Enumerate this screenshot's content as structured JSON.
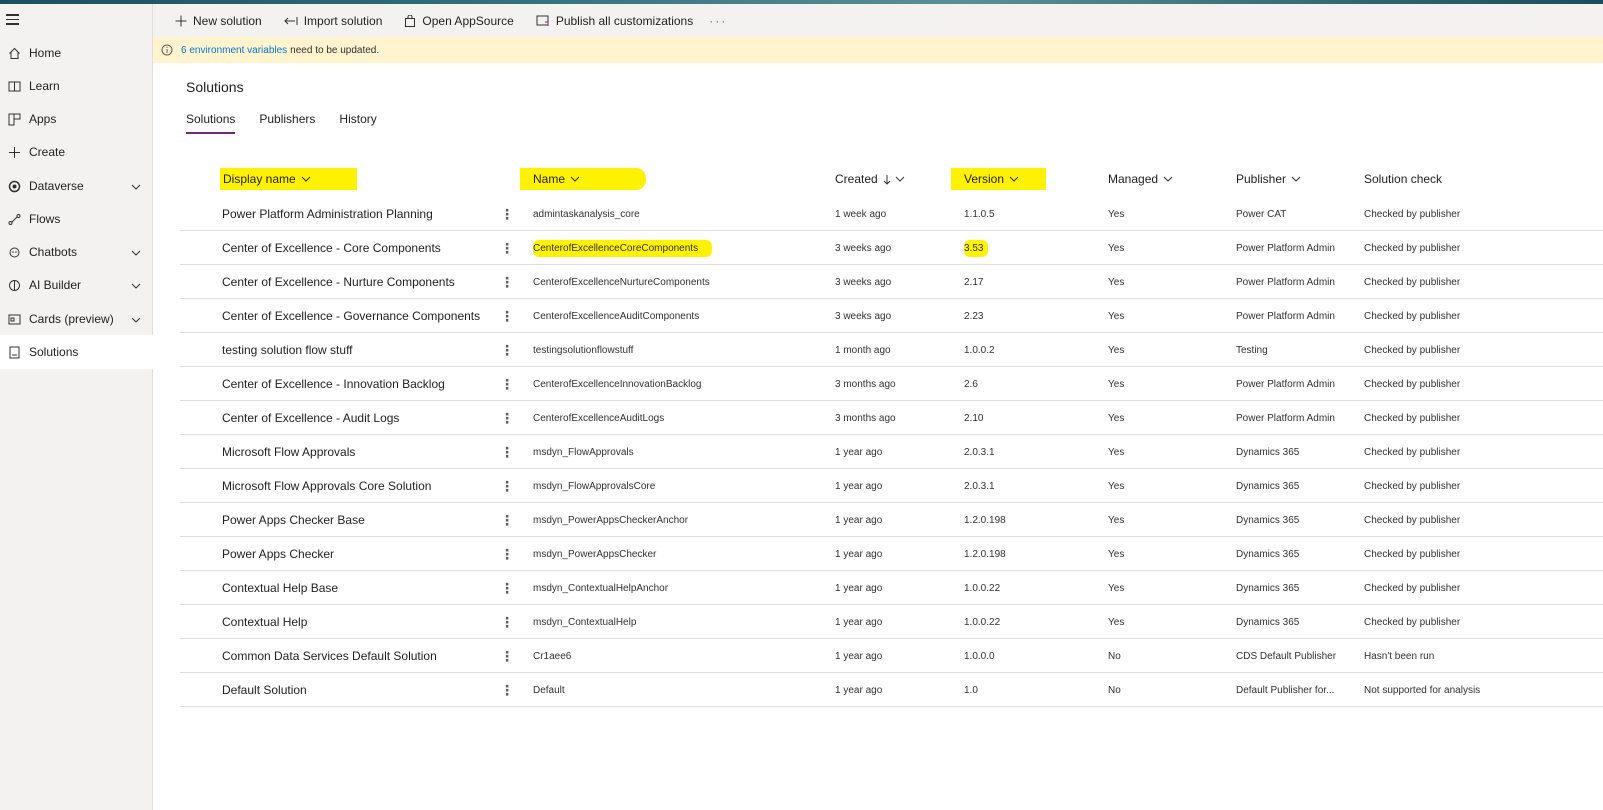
{
  "command_bar": {
    "new_solution": "New solution",
    "import_solution": "Import solution",
    "open_appsource": "Open AppSource",
    "publish_all": "Publish all customizations",
    "more": "···"
  },
  "banner": {
    "link_text": "6 environment variables",
    "rest_text": "need to be updated."
  },
  "sidebar": {
    "items": [
      {
        "label": "Home",
        "icon": "home-icon"
      },
      {
        "label": "Learn",
        "icon": "book-icon"
      },
      {
        "label": "Apps",
        "icon": "apps-icon"
      },
      {
        "label": "Create",
        "icon": "plus-icon"
      },
      {
        "label": "Dataverse",
        "icon": "dataverse-icon",
        "expandable": true
      },
      {
        "label": "Flows",
        "icon": "flow-icon"
      },
      {
        "label": "Chatbots",
        "icon": "chatbot-icon",
        "expandable": true
      },
      {
        "label": "AI Builder",
        "icon": "ai-builder-icon",
        "expandable": true
      },
      {
        "label": "Cards (preview)",
        "icon": "cards-icon",
        "expandable": true
      },
      {
        "label": "Solutions",
        "icon": "solutions-icon",
        "active": true
      }
    ]
  },
  "page": {
    "title": "Solutions",
    "tabs": [
      "Solutions",
      "Publishers",
      "History"
    ],
    "active_tab": "Solutions"
  },
  "columns": {
    "display_name": "Display name",
    "name": "Name",
    "created": "Created",
    "version": "Version",
    "managed": "Managed",
    "publisher": "Publisher",
    "solution_check": "Solution check"
  },
  "rows": [
    {
      "display_name": "Power Platform Administration Planning",
      "name": "admintaskanalysis_core",
      "created": "1 week ago",
      "version": "1.1.0.5",
      "managed": "Yes",
      "publisher": "Power CAT",
      "check": "Checked by publisher"
    },
    {
      "display_name": "Center of Excellence - Core Components",
      "name": "CenterofExcellenceCoreComponents",
      "created": "3 weeks ago",
      "version": "3.53",
      "managed": "Yes",
      "publisher": "Power Platform Admin",
      "check": "Checked by publisher"
    },
    {
      "display_name": "Center of Excellence - Nurture Components",
      "name": "CenterofExcellenceNurtureComponents",
      "created": "3 weeks ago",
      "version": "2.17",
      "managed": "Yes",
      "publisher": "Power Platform Admin",
      "check": "Checked by publisher"
    },
    {
      "display_name": "Center of Excellence - Governance Components",
      "name": "CenterofExcellenceAuditComponents",
      "created": "3 weeks ago",
      "version": "2.23",
      "managed": "Yes",
      "publisher": "Power Platform Admin",
      "check": "Checked by publisher"
    },
    {
      "display_name": "testing solution flow stuff",
      "name": "testingsolutionflowstuff",
      "created": "1 month ago",
      "version": "1.0.0.2",
      "managed": "Yes",
      "publisher": "Testing",
      "check": "Checked by publisher"
    },
    {
      "display_name": "Center of Excellence - Innovation Backlog",
      "name": "CenterofExcellenceInnovationBacklog",
      "created": "3 months ago",
      "version": "2.6",
      "managed": "Yes",
      "publisher": "Power Platform Admin",
      "check": "Checked by publisher"
    },
    {
      "display_name": "Center of Excellence - Audit Logs",
      "name": "CenterofExcellenceAuditLogs",
      "created": "3 months ago",
      "version": "2.10",
      "managed": "Yes",
      "publisher": "Power Platform Admin",
      "check": "Checked by publisher"
    },
    {
      "display_name": "Microsoft Flow Approvals",
      "name": "msdyn_FlowApprovals",
      "created": "1 year ago",
      "version": "2.0.3.1",
      "managed": "Yes",
      "publisher": "Dynamics 365",
      "check": "Checked by publisher"
    },
    {
      "display_name": "Microsoft Flow Approvals Core Solution",
      "name": "msdyn_FlowApprovalsCore",
      "created": "1 year ago",
      "version": "2.0.3.1",
      "managed": "Yes",
      "publisher": "Dynamics 365",
      "check": "Checked by publisher"
    },
    {
      "display_name": "Power Apps Checker Base",
      "name": "msdyn_PowerAppsCheckerAnchor",
      "created": "1 year ago",
      "version": "1.2.0.198",
      "managed": "Yes",
      "publisher": "Dynamics 365",
      "check": "Checked by publisher"
    },
    {
      "display_name": "Power Apps Checker",
      "name": "msdyn_PowerAppsChecker",
      "created": "1 year ago",
      "version": "1.2.0.198",
      "managed": "Yes",
      "publisher": "Dynamics 365",
      "check": "Checked by publisher"
    },
    {
      "display_name": "Contextual Help Base",
      "name": "msdyn_ContextualHelpAnchor",
      "created": "1 year ago",
      "version": "1.0.0.22",
      "managed": "Yes",
      "publisher": "Dynamics 365",
      "check": "Checked by publisher"
    },
    {
      "display_name": "Contextual Help",
      "name": "msdyn_ContextualHelp",
      "created": "1 year ago",
      "version": "1.0.0.22",
      "managed": "Yes",
      "publisher": "Dynamics 365",
      "check": "Checked by publisher"
    },
    {
      "display_name": "Common Data Services Default Solution",
      "name": "Cr1aee6",
      "created": "1 year ago",
      "version": "1.0.0.0",
      "managed": "No",
      "publisher": "CDS Default Publisher",
      "check": "Hasn't been run"
    },
    {
      "display_name": "Default Solution",
      "name": "Default",
      "created": "1 year ago",
      "version": "1.0",
      "managed": "No",
      "publisher": "Default Publisher for...",
      "check": "Not supported for analysis"
    }
  ],
  "highlight_color": "#fff200",
  "accent_color": "#742774"
}
